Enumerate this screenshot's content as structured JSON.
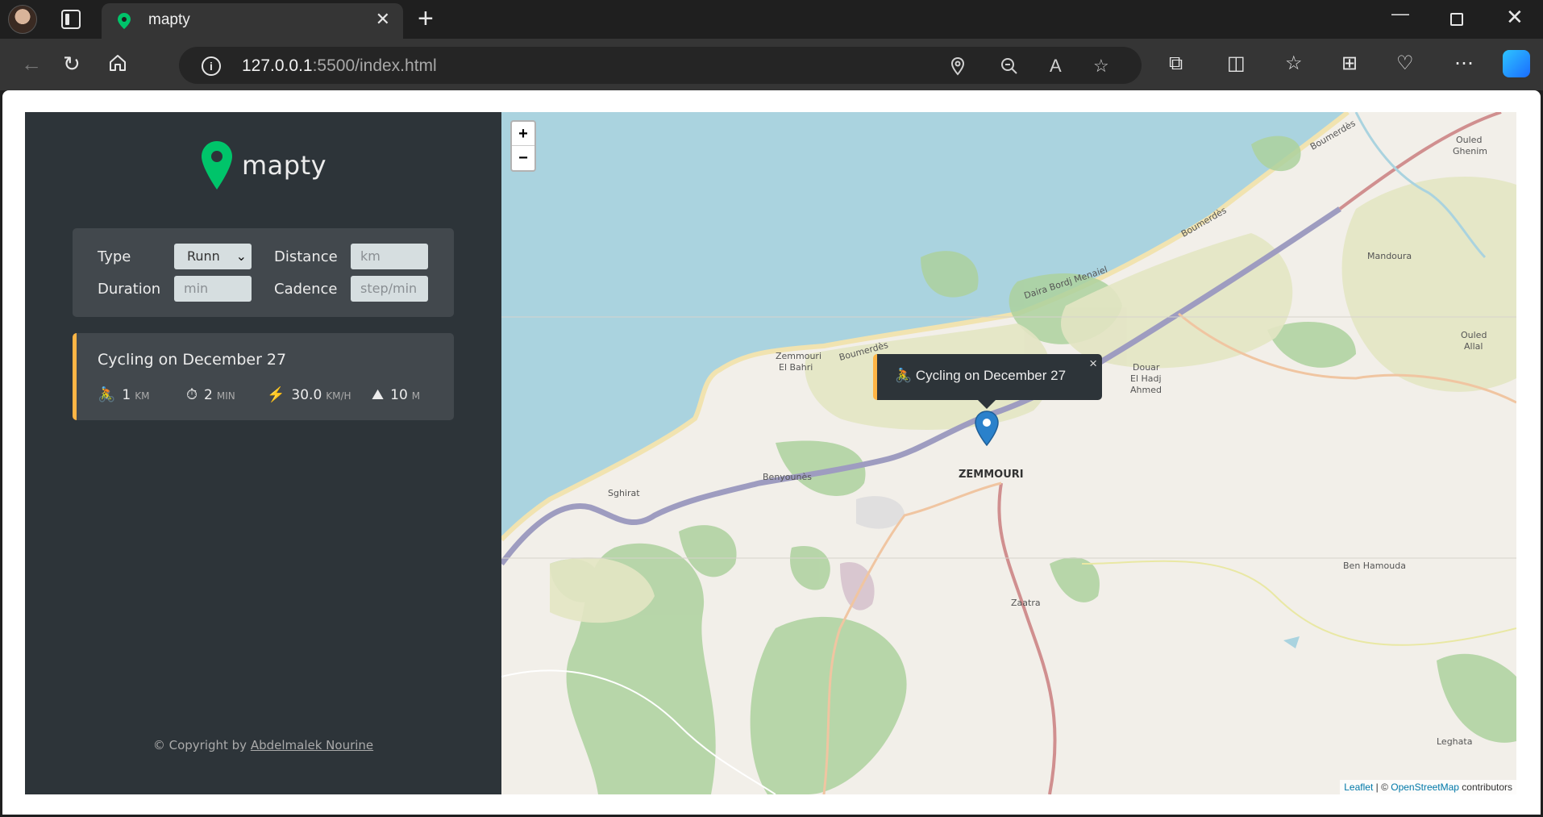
{
  "browser": {
    "tab_title": "mapty",
    "url_host": "127.0.0.1",
    "url_rest": ":5500/index.html",
    "new_tab_glyph": "+",
    "close_glyph": "✕"
  },
  "sidebar": {
    "logo_text": "mapty",
    "form": {
      "type_label": "Type",
      "type_value": "Runn",
      "distance_label": "Distance",
      "distance_placeholder": "km",
      "duration_label": "Duration",
      "duration_placeholder": "min",
      "cadence_label": "Cadence",
      "cadence_placeholder": "step/min"
    },
    "workout": {
      "title": "Cycling on December 27",
      "details": [
        {
          "icon": "🚴",
          "value": "1",
          "unit": "km"
        },
        {
          "icon": "⏱",
          "value": "2",
          "unit": "min"
        },
        {
          "icon": "⚡️",
          "value": "30.0",
          "unit": "km/h"
        },
        {
          "icon": "⛰",
          "value": "10",
          "unit": "m"
        }
      ]
    },
    "copyright_prefix": "© Copyright by ",
    "copyright_author": "Abdelmalek Nourine"
  },
  "map": {
    "zoom_in": "+",
    "zoom_out": "−",
    "popup_icon": "🚴",
    "popup_text": "Cycling on December 27",
    "popup_close": "×",
    "attribution_leaflet": "Leaflet",
    "attribution_sep": " | © ",
    "attribution_osm": "OpenStreetMap",
    "attribution_tail": " contributors",
    "places": {
      "zemmouri": "ZEMMOURI",
      "zemmouri_bahri_1": "Zemmouri",
      "zemmouri_bahri_2": "El Bahri",
      "boumerdes_1": "Boumerdès",
      "boumerdes_2": "Boumerdès",
      "boumerdes_3": "Boumerdès",
      "daira": "Daira Bordj Menaiel",
      "ouled_ghenim_1": "Ouled",
      "ouled_ghenim_2": "Ghenim",
      "mandoura": "Mandoura",
      "ouled_allal_1": "Ouled",
      "ouled_allal_2": "Allal",
      "douar_1": "Douar",
      "douar_2": "El Hadj",
      "douar_3": "Ahmed",
      "sghirat": "Sghirat",
      "benyounes": "Benyounès",
      "zaatra": "Zaatra",
      "ben_hamouda": "Ben Hamouda",
      "leghata": "Leghata"
    }
  },
  "colors": {
    "sidebar_bg": "#2d3439",
    "card_bg": "#42484d",
    "cycling_accent": "#ffb545",
    "brand_green": "#00c46a",
    "sea": "#aad3df"
  }
}
